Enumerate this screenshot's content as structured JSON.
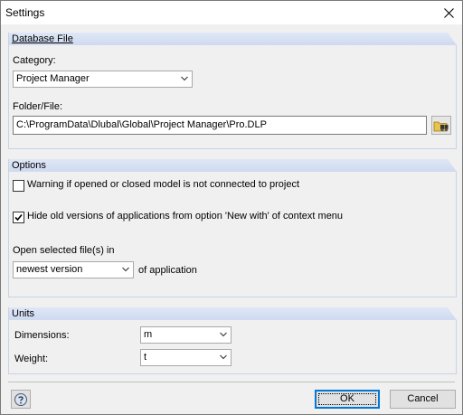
{
  "window": {
    "title": "Settings"
  },
  "database_file": {
    "header": "Database File",
    "category_label": "Category:",
    "category_value": "Project Manager",
    "folder_label": "Folder/File:",
    "folder_value": "C:\\ProgramData\\Dlubal\\Global\\Project Manager\\Pro.DLP"
  },
  "options": {
    "header": "Options",
    "warning_label": "Warning if opened or closed model is not connected to project",
    "warning_checked": false,
    "hide_old_label": "Hide old versions of applications from option 'New with' of context menu",
    "hide_old_checked": true,
    "open_selected_label": "Open selected file(s) in",
    "open_selected_value": "newest version",
    "of_application_label": "of application"
  },
  "units": {
    "header": "Units",
    "dimensions_label": "Dimensions:",
    "dimensions_value": "m",
    "weight_label": "Weight:",
    "weight_value": "t"
  },
  "footer": {
    "ok_label": "OK",
    "cancel_label": "Cancel"
  },
  "icons": {
    "close": "close-icon",
    "browse": "folder-browse-icon",
    "help": "help-icon",
    "dropdown": "chevron-down-icon",
    "check": "checkmark-icon"
  },
  "colors": {
    "group_header": "#cfdaf0",
    "default_button_border": "#0078d7",
    "window_bg": "#f0f0f0"
  }
}
